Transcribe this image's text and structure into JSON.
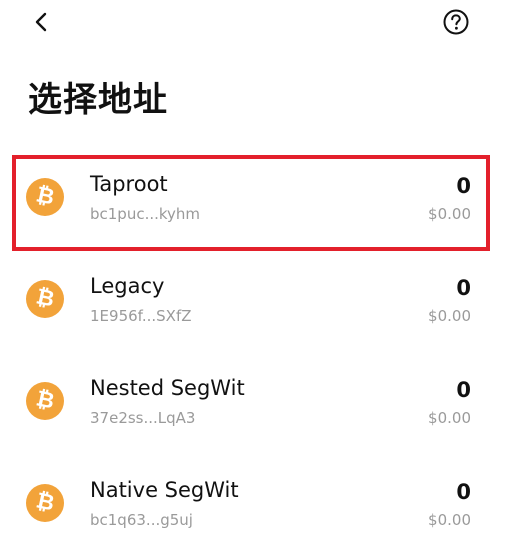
{
  "header": {
    "back_icon": "chevron-left-icon",
    "help_icon": "question-circle-icon",
    "title": "选择地址"
  },
  "addresses": [
    {
      "name": "Taproot",
      "address": "bc1puc...kyhm",
      "balance": "0",
      "fiat": "$0.00",
      "selected": true,
      "icon": "bitcoin-icon"
    },
    {
      "name": "Legacy",
      "address": "1E956f...SXfZ",
      "balance": "0",
      "fiat": "$0.00",
      "selected": false,
      "icon": "bitcoin-icon"
    },
    {
      "name": "Nested SegWit",
      "address": "37e2ss...LqA3",
      "balance": "0",
      "fiat": "$0.00",
      "selected": false,
      "icon": "bitcoin-icon"
    },
    {
      "name": "Native SegWit",
      "address": "bc1q63...g5uj",
      "balance": "0",
      "fiat": "$0.00",
      "selected": false,
      "icon": "bitcoin-icon"
    }
  ],
  "colors": {
    "bitcoin_orange": "#f2a33a",
    "selection_border": "#e3202b",
    "secondary_text": "#9a9a9a"
  }
}
